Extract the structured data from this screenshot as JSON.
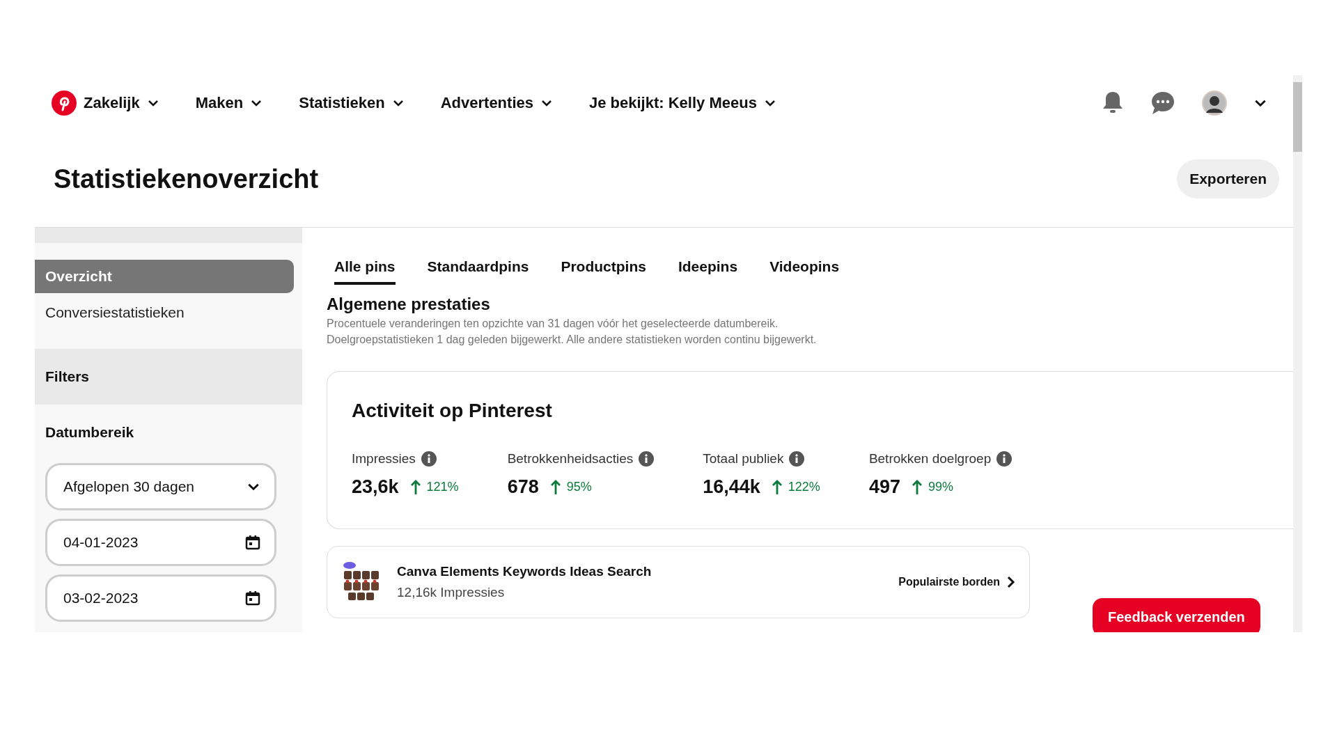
{
  "nav": {
    "items": [
      {
        "label": "Zakelijk"
      },
      {
        "label": "Maken"
      },
      {
        "label": "Statistieken"
      },
      {
        "label": "Advertenties"
      },
      {
        "label": "Je bekijkt: Kelly Meeus"
      }
    ]
  },
  "header": {
    "title": "Statistiekenoverzicht",
    "export_button": "Exporteren"
  },
  "sidebar": {
    "items": [
      {
        "label": "Overzicht",
        "selected": true
      },
      {
        "label": "Conversiestatistieken",
        "selected": false
      }
    ],
    "filters_title": "Filters",
    "date_range_label": "Datumbereik",
    "range_select": "Afgelopen 30 dagen",
    "start_date": "04-01-2023",
    "end_date": "03-02-2023"
  },
  "tabs": [
    {
      "label": "Alle pins",
      "selected": true
    },
    {
      "label": "Standaardpins",
      "selected": false
    },
    {
      "label": "Productpins",
      "selected": false
    },
    {
      "label": "Ideepins",
      "selected": false
    },
    {
      "label": "Videopins",
      "selected": false
    }
  ],
  "section": {
    "title": "Algemene prestaties",
    "notes": [
      "Procentuele veranderingen ten opzichte van 31 dagen vóór het geselecteerde datumbereik.",
      "Doelgroepstatistieken 1 dag geleden bijgewerkt. Alle andere statistieken worden continu bijgewerkt."
    ]
  },
  "activity": {
    "title": "Activiteit op Pinterest",
    "metrics": [
      {
        "label": "Impressies",
        "value": "23,6k",
        "change": "121%"
      },
      {
        "label": "Betrokkenheidsacties",
        "value": "678",
        "change": "95%"
      },
      {
        "label": "Totaal publiek",
        "value": "16,44k",
        "change": "122%"
      },
      {
        "label": "Betrokken doelgroep",
        "value": "497",
        "change": "99%"
      }
    ]
  },
  "top_pin": {
    "title": "Canva Elements Keywords Ideas Search",
    "impressions": "12,16k Impressies",
    "link": "Populairste borden"
  },
  "feedback_button": "Feedback verzenden"
}
